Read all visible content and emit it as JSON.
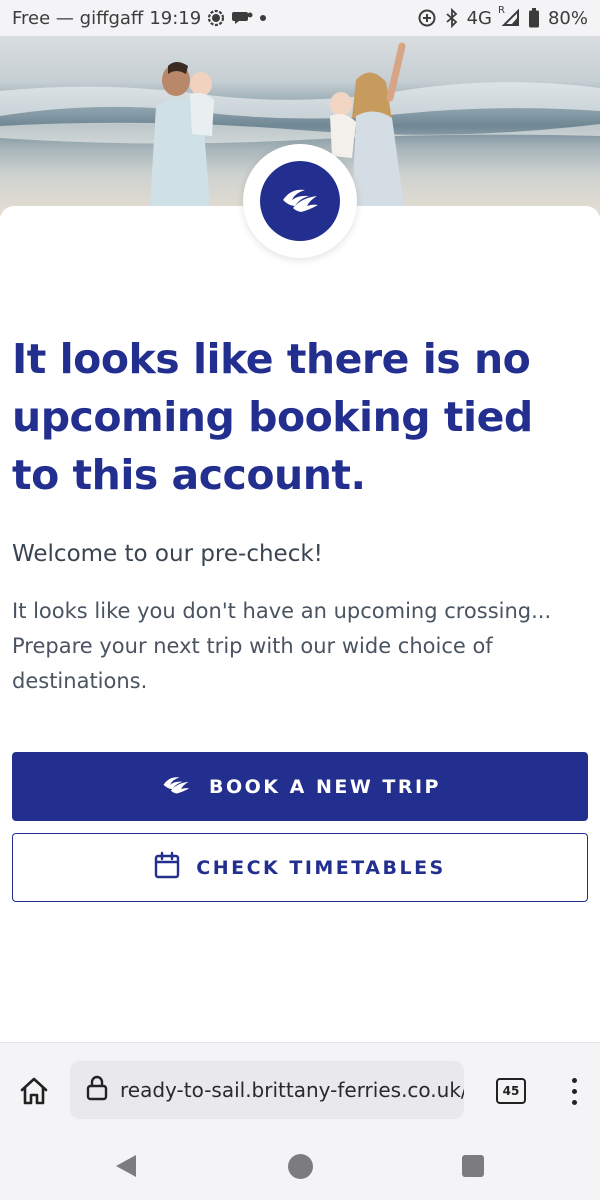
{
  "status_bar": {
    "carrier": "Free — giffgaff",
    "time": "19:19",
    "network": "4G",
    "roaming": "R",
    "battery": "80%"
  },
  "brand": {
    "primary": "#232f8f"
  },
  "content": {
    "headline": "It looks like there is no upcoming booking tied to this account.",
    "subtitle": "Welcome to our pre-check!",
    "body": "It looks like you don't have an upcoming crossing... Prepare your next trip with our wide choice of destinations."
  },
  "buttons": {
    "book_label": "BOOK A NEW TRIP",
    "timetables_label": "CHECK TIMETABLES"
  },
  "browser": {
    "url": "ready-to-sail.brittany-ferries.co.uk/r",
    "tab_count": "45"
  },
  "icons": {
    "logo": "brittany-ferries-wave-icon",
    "calendar": "calendar-icon",
    "home": "home-icon",
    "lock": "lock-icon",
    "menu": "more-vert-icon"
  }
}
